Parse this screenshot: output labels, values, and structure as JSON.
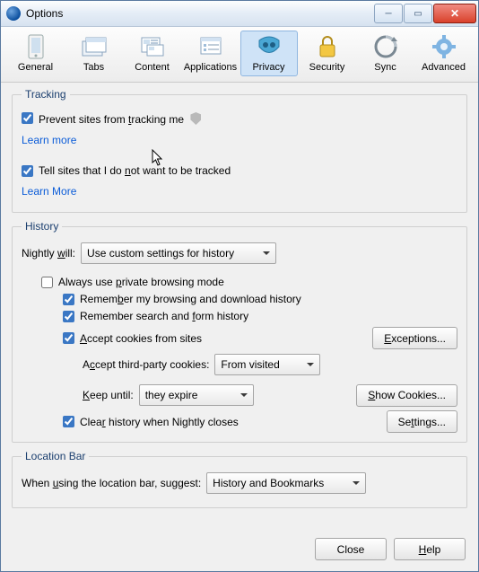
{
  "window": {
    "title": "Options"
  },
  "toolbar": {
    "items": [
      {
        "label": "General"
      },
      {
        "label": "Tabs"
      },
      {
        "label": "Content"
      },
      {
        "label": "Applications"
      },
      {
        "label": "Privacy"
      },
      {
        "label": "Security"
      },
      {
        "label": "Sync"
      },
      {
        "label": "Advanced"
      }
    ],
    "selected_index": 4
  },
  "tracking": {
    "legend": "Tracking",
    "prevent": {
      "checked": true,
      "label_pre": "Prevent sites from ",
      "label_u": "t",
      "label_post": "racking me"
    },
    "learn_more_1": "Learn more",
    "dnt": {
      "checked": true,
      "label_pre": "Tell sites that I do ",
      "label_u": "n",
      "label_post": "ot want to be tracked"
    },
    "learn_more_2": "Learn More"
  },
  "history": {
    "legend": "History",
    "nightly_will_pre": "Nightly ",
    "nightly_will_u": "w",
    "nightly_will_post": "ill:",
    "mode_select": "Use custom settings for history",
    "always_private": {
      "checked": false,
      "label_pre": "Always use ",
      "label_u": "p",
      "label_post": "rivate browsing mode"
    },
    "remember_browse": {
      "checked": true,
      "label_pre": "Remem",
      "label_u": "b",
      "label_post": "er my browsing and download history"
    },
    "remember_form": {
      "checked": true,
      "label_pre": "Remember search and ",
      "label_u": "f",
      "label_post": "orm history"
    },
    "accept_cookies": {
      "checked": true,
      "label_pre": "",
      "label_u": "A",
      "label_post": "ccept cookies from sites"
    },
    "exceptions_btn_pre": "",
    "exceptions_btn_u": "E",
    "exceptions_btn_post": "xceptions...",
    "third_party_label_pre": "A",
    "third_party_label_u": "c",
    "third_party_label_post": "cept third-party cookies:",
    "third_party_value": "From visited",
    "keep_until_label_pre": "",
    "keep_until_label_u": "K",
    "keep_until_label_post": "eep until:",
    "keep_until_value": "they expire",
    "show_cookies_pre": "",
    "show_cookies_u": "S",
    "show_cookies_post": "how Cookies...",
    "clear_close": {
      "checked": true,
      "label_pre": "Clea",
      "label_u": "r",
      "label_post": " history when Nightly closes"
    },
    "settings_btn_pre": "Se",
    "settings_btn_u": "t",
    "settings_btn_post": "tings..."
  },
  "location_bar": {
    "legend": "Location Bar",
    "suggest_pre": "When ",
    "suggest_u": "u",
    "suggest_post": "sing the location bar, suggest:",
    "value": "History and Bookmarks"
  },
  "footer": {
    "close": "Close",
    "help_u": "H",
    "help_post": "elp"
  }
}
